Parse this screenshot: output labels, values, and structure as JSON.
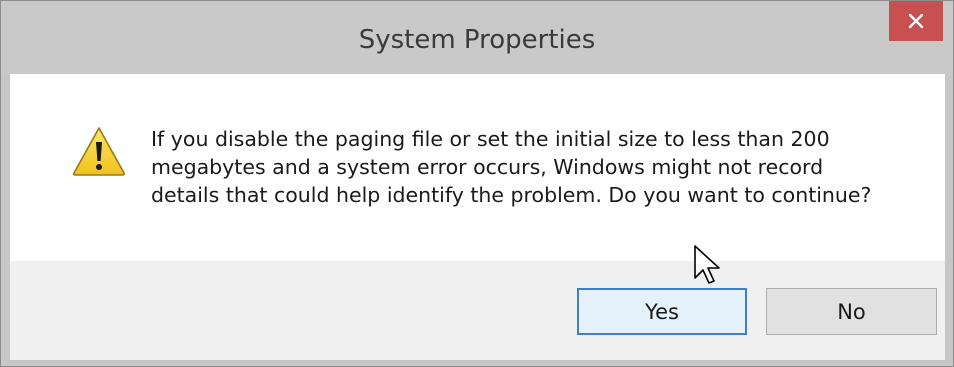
{
  "dialog": {
    "title": "System Properties",
    "close_glyph": "✕",
    "icon": "warning-icon",
    "message_lines": [
      "If you disable the paging file or set the initial size to less than 200",
      "megabytes and a system error occurs, Windows might not record",
      "details that could help identify the problem. Do you want to continue?"
    ],
    "buttons": {
      "yes_label": "Yes",
      "no_label": "No"
    }
  },
  "colors": {
    "titlebar": "#c9c9c9",
    "close_button": "#c75050",
    "button_bar": "#f0f0f0",
    "focused_border": "#3c7fd1",
    "warning_yellow": "#f5d13a"
  },
  "cursor": "pointer-cursor-icon"
}
